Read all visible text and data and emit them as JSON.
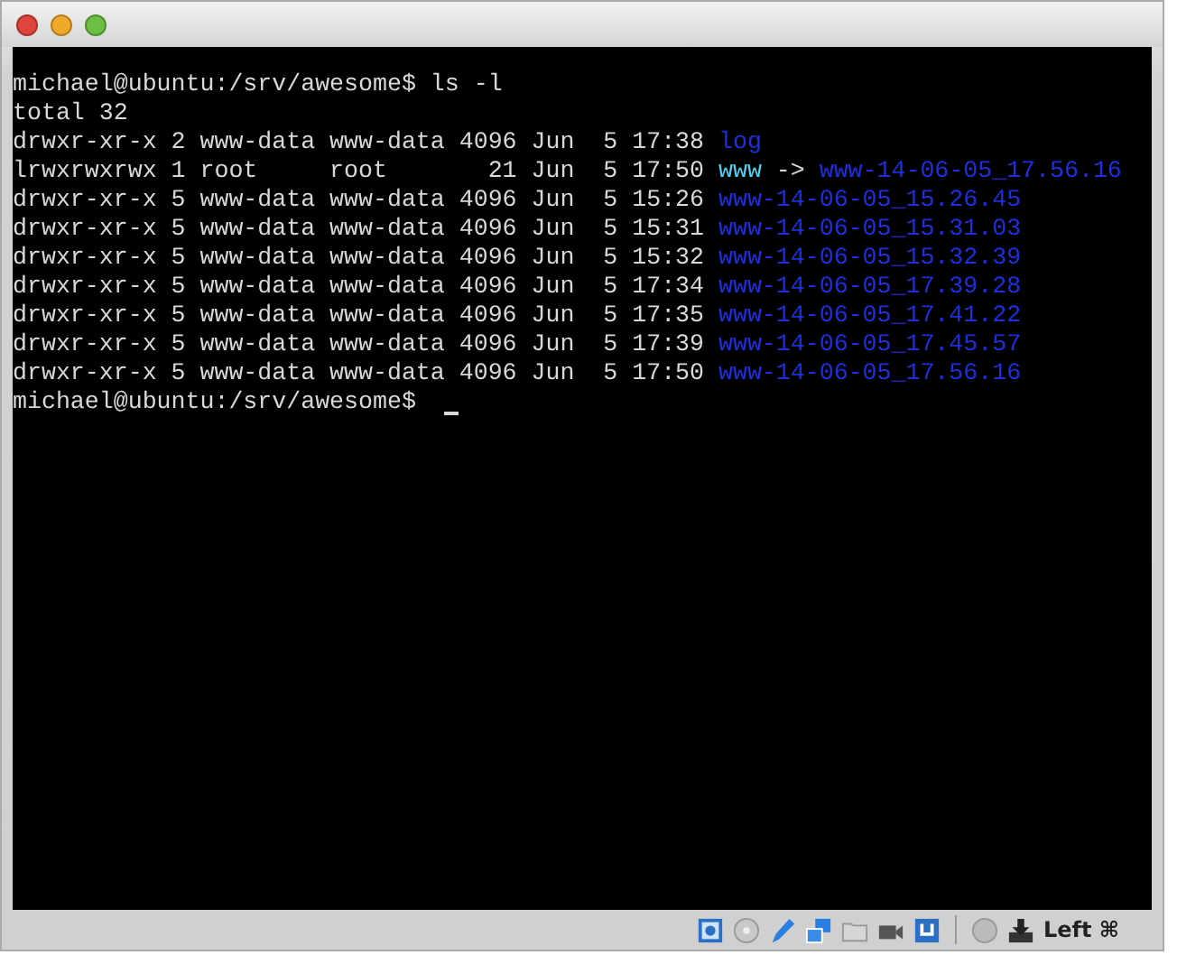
{
  "window": {
    "buttons": [
      {
        "kind": "close"
      },
      {
        "kind": "minimize"
      },
      {
        "kind": "zoom"
      }
    ]
  },
  "terminal": {
    "lines": [
      {
        "kind": "prompt",
        "text": "michael@ubuntu:/srv/awesome$ ls -l",
        "cursor": false
      },
      {
        "kind": "output",
        "text": "total 32"
      },
      {
        "kind": "entry",
        "info": "drwxr-xr-x 2 www-data www-data 4096 Jun  5 17:38",
        "name": {
          "text": "log",
          "kind": "dir"
        }
      },
      {
        "kind": "entry",
        "info": "lrwxrwxrwx 1 root     root       21 Jun  5 17:50",
        "name": {
          "text": "www",
          "kind": "symlink"
        },
        "arrow": "->",
        "target": "www-14-06-05_17.56.16"
      },
      {
        "kind": "entry",
        "info": "drwxr-xr-x 5 www-data www-data 4096 Jun  5 15:26",
        "name": {
          "text": "www-14-06-05_15.26.45",
          "kind": "dir"
        }
      },
      {
        "kind": "entry",
        "info": "drwxr-xr-x 5 www-data www-data 4096 Jun  5 15:31",
        "name": {
          "text": "www-14-06-05_15.31.03",
          "kind": "dir"
        }
      },
      {
        "kind": "entry",
        "info": "drwxr-xr-x 5 www-data www-data 4096 Jun  5 15:32",
        "name": {
          "text": "www-14-06-05_15.32.39",
          "kind": "dir"
        }
      },
      {
        "kind": "entry",
        "info": "drwxr-xr-x 5 www-data www-data 4096 Jun  5 17:34",
        "name": {
          "text": "www-14-06-05_17.39.28",
          "kind": "dir"
        }
      },
      {
        "kind": "entry",
        "info": "drwxr-xr-x 5 www-data www-data 4096 Jun  5 17:35",
        "name": {
          "text": "www-14-06-05_17.41.22",
          "kind": "dir"
        }
      },
      {
        "kind": "entry",
        "info": "drwxr-xr-x 5 www-data www-data 4096 Jun  5 17:39",
        "name": {
          "text": "www-14-06-05_17.45.57",
          "kind": "dir"
        }
      },
      {
        "kind": "entry",
        "info": "drwxr-xr-x 5 www-data www-data 4096 Jun  5 17:50",
        "name": {
          "text": "www-14-06-05_17.56.16",
          "kind": "dir"
        }
      },
      {
        "kind": "prompt",
        "text": "michael@ubuntu:/srv/awesome$ ",
        "cursor": true
      }
    ]
  },
  "status_bar": {
    "icons": [
      {
        "kind": "disk"
      },
      {
        "kind": "cd"
      },
      {
        "kind": "pen"
      },
      {
        "kind": "network"
      },
      {
        "kind": "folder"
      },
      {
        "kind": "camera"
      },
      {
        "kind": "usb"
      },
      {
        "kind": "separator"
      },
      {
        "kind": "globe"
      },
      {
        "kind": "download"
      }
    ],
    "host_key": "Left ⌘"
  }
}
